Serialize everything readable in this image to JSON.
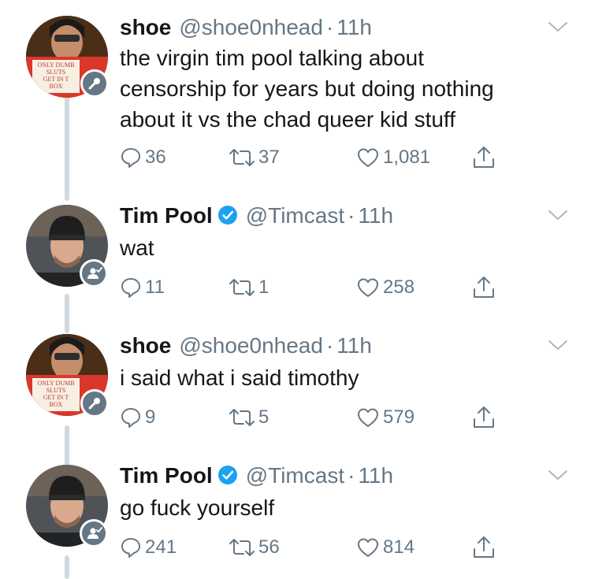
{
  "colors": {
    "text": "#14171a",
    "muted": "#657786",
    "verified": "#1da1f2",
    "thread_line": "#cfd9de",
    "badge": "#657786"
  },
  "tweets": [
    {
      "name": "shoe",
      "handle": "@shoe0nhead",
      "dot": "·",
      "time": "11h",
      "verified": false,
      "avatar_sign": [
        "ONLY DUMB",
        "SLUTS",
        "GET IN T",
        "BOX"
      ],
      "badge_icon": "microphone-icon",
      "lines": [
        "the virgin tim pool talking about",
        "censorship for years but doing nothing",
        "about it vs the chad queer kid stuff"
      ],
      "replies": "36",
      "retweets": "37",
      "likes": "1,081"
    },
    {
      "name": "Tim Pool",
      "handle": "@Timcast",
      "dot": "·",
      "time": "11h",
      "verified": true,
      "badge_icon": "person-check-icon",
      "lines": [
        "wat"
      ],
      "replies": "11",
      "retweets": "1",
      "likes": "258"
    },
    {
      "name": "shoe",
      "handle": "@shoe0nhead",
      "dot": "·",
      "time": "11h",
      "verified": false,
      "avatar_sign": [
        "ONLY DUMB",
        "SLUTS",
        "GET IN T",
        "BOX"
      ],
      "badge_icon": "microphone-icon",
      "lines": [
        "i said what i said timothy"
      ],
      "replies": "9",
      "retweets": "5",
      "likes": "579"
    },
    {
      "name": "Tim Pool",
      "handle": "@Timcast",
      "dot": "·",
      "time": "11h",
      "verified": true,
      "badge_icon": "person-check-icon",
      "lines": [
        "go fuck yourself"
      ],
      "replies": "241",
      "retweets": "56",
      "likes": "814"
    }
  ]
}
